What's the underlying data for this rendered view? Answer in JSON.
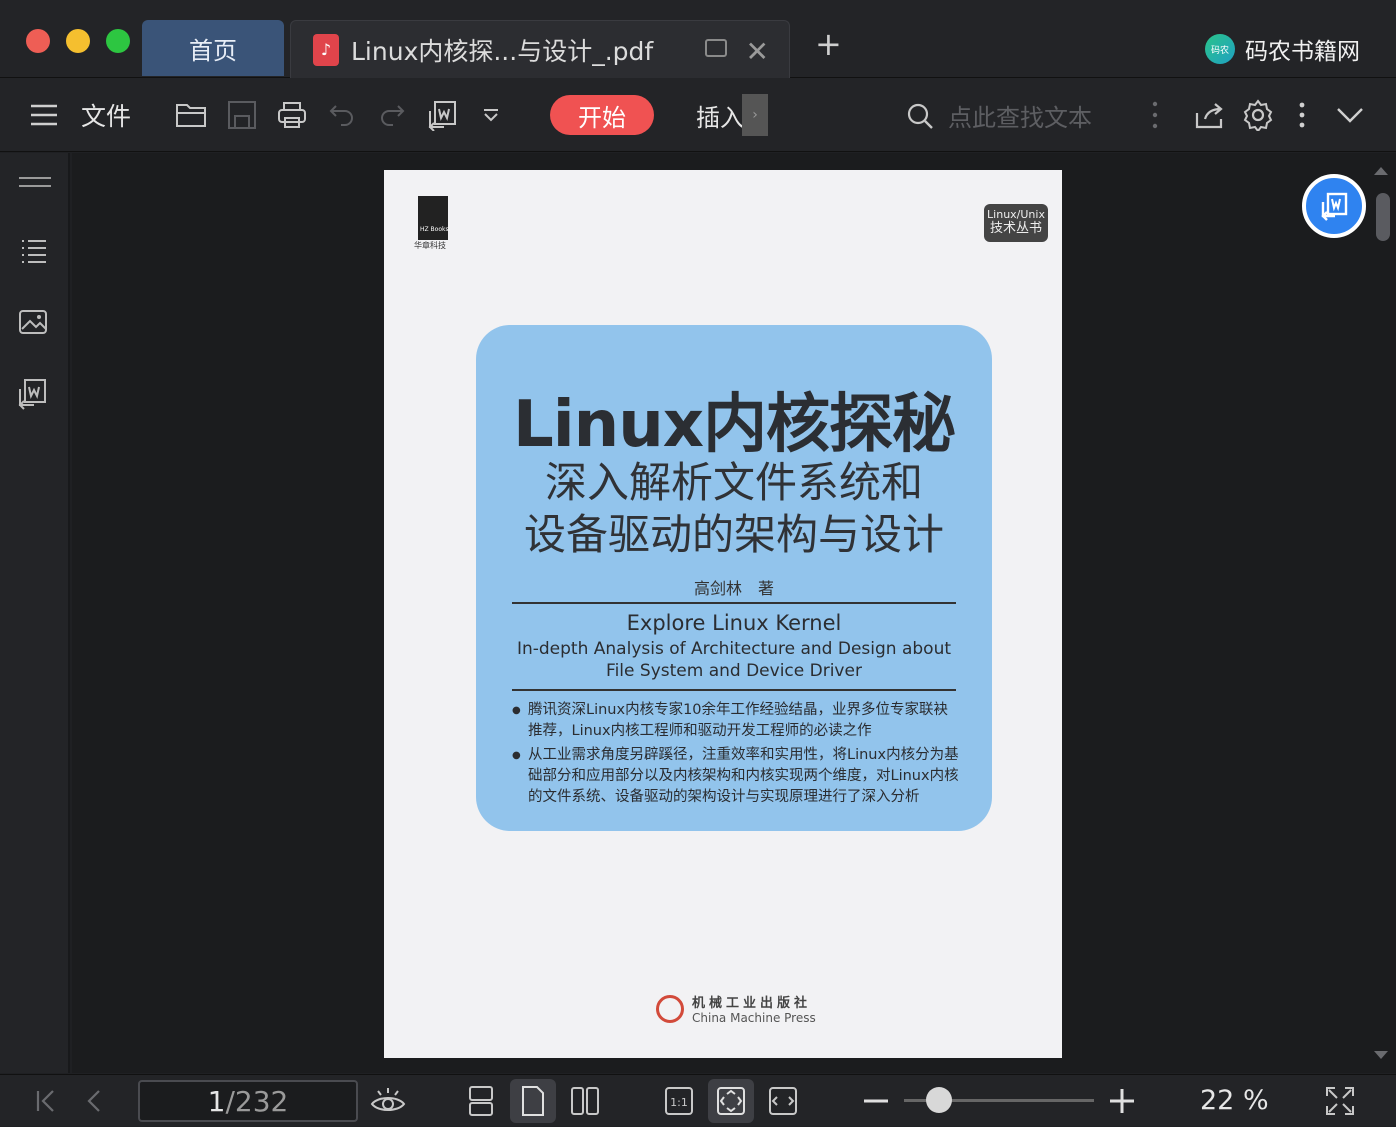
{
  "window": {
    "traffic_lights": {
      "close": "#ee5e55",
      "minimize": "#f5bf2f",
      "maximize": "#2dc641"
    },
    "tabs": {
      "home": "首页",
      "document": "Linux内核探...与设计_.pdf"
    },
    "brand": {
      "logo_text": "码农",
      "name": "码农书籍网"
    }
  },
  "toolbar": {
    "file_label": "文件",
    "start_label": "开始",
    "insert_label": "插入",
    "search_placeholder": "点此查找文本",
    "accent": "#f05252",
    "icons": [
      "menu-icon",
      "open-folder-icon",
      "save-icon",
      "print-icon",
      "undo-icon",
      "redo-icon",
      "convert-icon",
      "dropdown-icon",
      "search-icon",
      "more-icon",
      "share-icon",
      "settings-icon",
      "more-vertical-icon",
      "collapse-icon"
    ]
  },
  "sidebar": {
    "icons": [
      "hide-panel-icon",
      "outline-icon",
      "thumbnail-icon",
      "convert-word-icon"
    ]
  },
  "document": {
    "publisher_mark": "华章科技",
    "publisher_mark_en": "HZ Books",
    "series_badge": [
      "Linux/Unix",
      "技术丛书"
    ],
    "title": "Linux内核探秘",
    "subtitle_lines": [
      "深入解析文件系统和",
      "设备驱动的架构与设计"
    ],
    "author": "高剑林　著",
    "english_title": "Explore Linux Kernel",
    "english_subtitle_lines": [
      "In-depth Analysis of Architecture and Design about",
      "File System and Device Driver"
    ],
    "bullets": [
      "腾讯资深Linux内核专家10余年工作经验结晶，业界多位专家联袂推荐，Linux内核工程师和驱动开发工程师的必读之作",
      "从工业需求角度另辟蹊径，注重效率和实用性，将Linux内核分为基础部分和应用部分以及内核架构和内核实现两个维度，对Linux内核的文件系统、设备驱动的架构设计与实现原理进行了深入分析"
    ],
    "press_cn": "机械工业出版社",
    "press_en": "China Machine Press",
    "cover_color": "#92c4ec"
  },
  "statusbar": {
    "current_page": "1",
    "total_pages": "/232",
    "zoom_percent": 22,
    "zoom_label": "22 %"
  }
}
